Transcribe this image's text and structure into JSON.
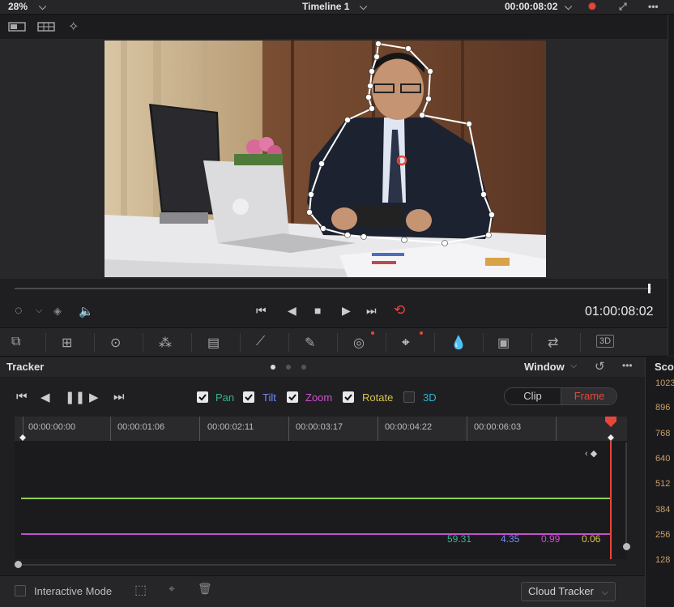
{
  "topbar": {
    "zoom": "28%",
    "timeline": "Timeline 1",
    "timecode": "00:00:08:02"
  },
  "transport": {
    "timecode": "01:00:08:02"
  },
  "tracker": {
    "title": "Tracker",
    "window_label": "Window",
    "params": [
      {
        "label": "Pan",
        "checked": true,
        "color": "#2fb88d"
      },
      {
        "label": "Tilt",
        "checked": true,
        "color": "#6f8cff"
      },
      {
        "label": "Zoom",
        "checked": true,
        "color": "#d14fd1"
      },
      {
        "label": "Rotate",
        "checked": true,
        "color": "#d6c64a"
      },
      {
        "label": "3D",
        "checked": false,
        "color": "#29b3d6"
      }
    ],
    "mode_toggle": {
      "clip": "Clip",
      "frame": "Frame",
      "active": "Frame"
    },
    "ruler_ticks": [
      "00:00:00:00",
      "00:00:01:06",
      "00:00:02:11",
      "00:00:03:17",
      "00:00:04:22",
      "00:00:06:03"
    ],
    "values": {
      "pan": "59.31",
      "tilt": "4.35",
      "zoom": "0.99",
      "rotate": "0.06"
    }
  },
  "bottom": {
    "interactive_mode": "Interactive Mode",
    "cloud_tracker": "Cloud Tracker"
  },
  "scopes": {
    "title": "Scop",
    "levels": [
      "1023",
      "896",
      "768",
      "640",
      "512",
      "384",
      "256",
      "128"
    ]
  },
  "colors": {
    "accent_red": "#e5473b",
    "tracker_line_green": "#8fcf5a",
    "tracker_line_magenta": "#c44fd1",
    "playhead": "#e5473b"
  }
}
